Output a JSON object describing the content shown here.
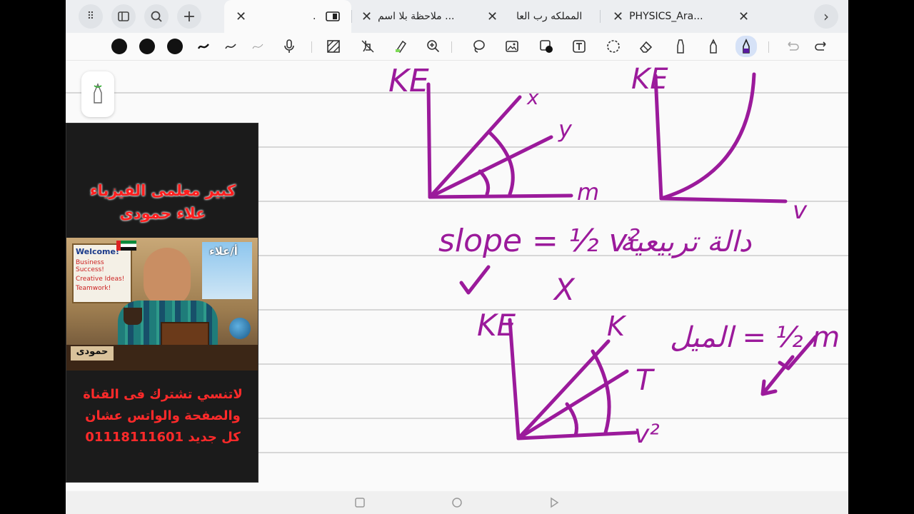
{
  "tabs": [
    {
      "title": "",
      "active": true
    },
    {
      "title": ".",
      "active": false
    },
    {
      "title": "ملاحظة بلا اسم ...",
      "active": false
    },
    {
      "title": "المملكه رب العا",
      "active": false
    },
    {
      "title": "PHYSICS_Ara...",
      "active": false
    },
    {
      "title": "",
      "active": false
    }
  ],
  "colors": {
    "ink": "#9b1a9b",
    "promo_red": "#ff1e1e"
  },
  "toolbar_icons": [
    "pen-black-1",
    "pen-black-2",
    "pen-black-3",
    "stroke-1",
    "stroke-2",
    "stroke-3",
    "microphone-icon",
    "shape-fill-icon",
    "touch-pen-icon",
    "highlighter-icon",
    "zoom-icon",
    "lasso-icon",
    "image-icon",
    "sticker-icon",
    "text-box-icon",
    "selection-icon",
    "eraser-icon",
    "marker-icon",
    "pencil-icon",
    "fountain-pen-icon",
    "undo-icon",
    "redo-icon"
  ],
  "promo": {
    "title_line1": "كبير معلمى الفيزياء",
    "title_line2": "علاء حمودى",
    "board_welcome": "Welcome!",
    "board_items": [
      "Business Success!",
      "Creative Ideas!",
      "Teamwork!"
    ],
    "badge": "أ/علاء",
    "desk_sign": "حمودى",
    "cta_line1": "لاتنسي تشترك فى القناة",
    "cta_line2": "والصفحة والواتس عشان",
    "cta_line3": "كل جديد 01118111601"
  },
  "handwriting": {
    "graph1": {
      "y_label": "KE",
      "lines": [
        "x",
        "y",
        "m"
      ]
    },
    "graph2": {
      "y_label": "KE",
      "x_label": "v"
    },
    "note1": "slope = ½ v²",
    "note2": "دالة تربيعية",
    "check": "✓",
    "cross": "X",
    "graph3": {
      "y_label": "KE",
      "lines": [
        "K",
        "T",
        "v²"
      ]
    },
    "note3": "الميل = ½ m"
  }
}
